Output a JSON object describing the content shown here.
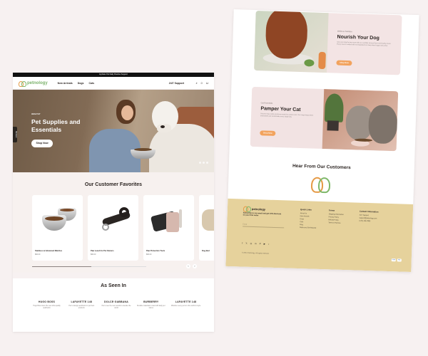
{
  "screen1": {
    "announcement": "Hydrate Pet Daily Routine Support",
    "logo_text": "petnology",
    "nav": [
      "New Arrivals",
      "Dogs",
      "Cats"
    ],
    "support": "24/7 Support",
    "header_icons": [
      "search-icon",
      "user-icon",
      "cart-icon"
    ],
    "hero": {
      "eyebrow": "HEALTHY",
      "title": "Pet Supplies and Essentials",
      "button": "Shop Now",
      "side_tab": "Reviews"
    },
    "favorites": {
      "title": "Our Customer Favorites",
      "progress": 0.52,
      "products": [
        {
          "name": "Stainless & Advanced Matches",
          "price": "$00.00"
        },
        {
          "name": "Paw Leash for Pet Owners",
          "price": "$00.00"
        },
        {
          "name": "Paw Protection Tools",
          "price": "$00.00"
        },
        {
          "name": "Dog Bed",
          "price": ""
        }
      ],
      "prev": "‹",
      "next": "›"
    },
    "as_seen": {
      "title": "As Seen In",
      "brands": [
        {
          "name": "HUGO BOSS",
          "quote": "Hugo Boss loves the new ultra quality aesthetics"
        },
        {
          "name": "LAFAYETTE 148",
          "quote": "Pet to design aesthetics to pet best products"
        },
        {
          "name": "DOLCE·GABBANA",
          "quote": "Pet to see the new results to elevate the world"
        },
        {
          "name": "BURBERRY",
          "quote": "Durable materials to lead with daily pet stores"
        },
        {
          "name": "LAFAYETTE 148",
          "quote": "Whether every pet is in the world in style"
        }
      ]
    }
  },
  "screen2": {
    "dog_panel": {
      "eyebrow": "Wellness Nutrition",
      "title": "Nourish Your Dog",
      "text": "Give your dog the best start with our carefully sourced food and healthy treats. Every meal is crafted with real ingredients to keep them happy and active.",
      "button": "Shop Now"
    },
    "cat_panel": {
      "eyebrow": "Cat Essentials",
      "title": "Pamper Your Cat",
      "text": "Discover toys, beds and treats made for curious cats. Our range keeps them entertained and comfortable every single day.",
      "button": "Shop Now"
    },
    "testimonials_title": "Hear From Our Customers",
    "footer": {
      "logo_text": "petnology",
      "newsletter_text": "Subscribe to our email and get 10% discount on your first order",
      "email_placeholder": "Email",
      "social": [
        "f",
        "𝕏",
        "◎",
        "in",
        "P",
        "▶",
        "♪"
      ],
      "copyright": "© 2024 Petnology. All rights reserved.",
      "columns": [
        {
          "heading": "Quick Links",
          "items": [
            "About Us",
            "New Arrivals",
            "Dogs",
            "Cats",
            "Blog",
            "Refer and Get Reward"
          ]
        },
        {
          "heading": "Terms",
          "items": [
            "Shipping Information",
            "Privacy Policy",
            "Refund Policy",
            "Terms of Service"
          ]
        },
        {
          "heading": "Contact Information",
          "items": [
            "24/7 Support",
            "support@petnology.com",
            "(123) 456-7890"
          ]
        }
      ],
      "payments": [
        "VISA",
        "MC"
      ]
    }
  }
}
